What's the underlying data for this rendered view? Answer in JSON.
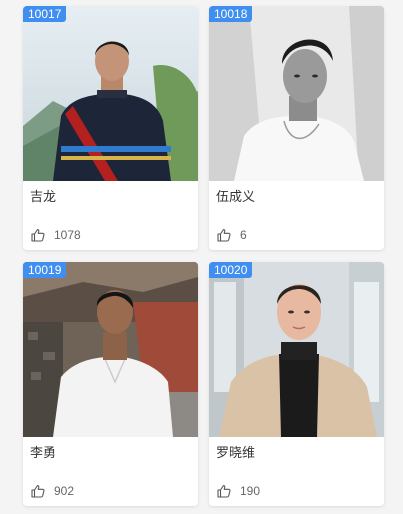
{
  "cards": [
    {
      "id": "10017",
      "name": "吉龙",
      "likes": "1078"
    },
    {
      "id": "10018",
      "name": "伍成义",
      "likes": "6"
    },
    {
      "id": "10019",
      "name": "李勇",
      "likes": "902"
    },
    {
      "id": "10020",
      "name": "罗晓维",
      "likes": "190"
    }
  ],
  "icons": {
    "like": "thumbs-up-icon"
  },
  "colors": {
    "badge": "#3f8ef0",
    "card_bg": "#ffffff",
    "page_bg": "#f4f4f4"
  }
}
